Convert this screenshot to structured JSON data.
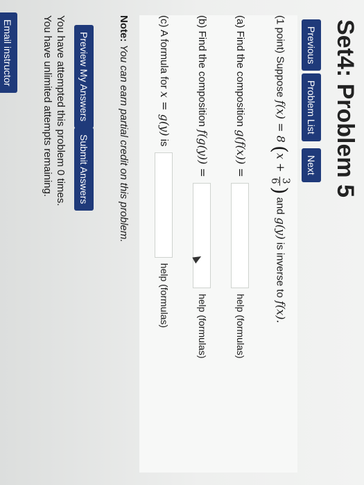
{
  "page": {
    "title": "Set4: Problem 5"
  },
  "nav": {
    "previous": "Previous",
    "problem_list": "Problem List",
    "next": "Next"
  },
  "problem": {
    "intro_prefix": "(1 point) Suppose",
    "intro_f": "f(x) = 8",
    "intro_inner": "x +",
    "frac_num": "3",
    "frac_den": "6",
    "intro_and": "and",
    "intro_g": "g(y)",
    "intro_suffix": "is inverse to",
    "intro_fx": "f(x).",
    "part_a_prefix": "(a) Find the composition",
    "part_a_math": "g(f(x)) =",
    "part_b_prefix": "(b) Find the composition",
    "part_b_math": "f(g(y)) =",
    "part_c_prefix": "(c) A formula for",
    "part_c_math": "x = g(y)",
    "part_c_is": "is",
    "help_label": "help (formulas)"
  },
  "note": {
    "label": "Note:",
    "text": "You can earn partial credit on this problem."
  },
  "actions": {
    "preview": "Preview My Answers",
    "submit": "Submit Answers"
  },
  "status": {
    "attempted": "You have attempted this problem 0 times.",
    "remaining": "You have unlimited attempts remaining."
  },
  "footer": {
    "email": "Email instructor"
  },
  "colors": {
    "button_bg": "#1f3a7a",
    "button_text": "#ffffff"
  }
}
